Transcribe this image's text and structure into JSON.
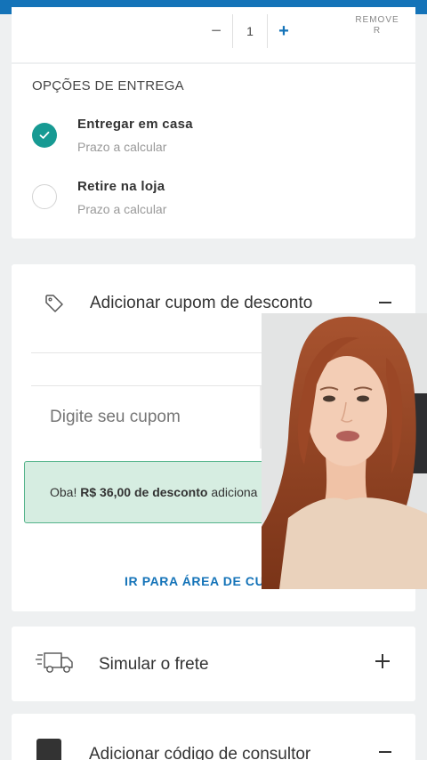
{
  "quantity": {
    "decrement_label": "−",
    "value": "1",
    "increment_label": "+",
    "remove_label": "REMOVE\nR"
  },
  "delivery": {
    "title": "OPÇÕES DE ENTREGA",
    "options": [
      {
        "label": "Entregar em casa",
        "sub": "Prazo a calcular",
        "selected": true
      },
      {
        "label": "Retire na loja",
        "sub": "Prazo a calcular",
        "selected": false
      }
    ]
  },
  "coupon": {
    "title": "Adicionar cupom de desconto",
    "input_placeholder": "Digite seu cupom",
    "success_prefix": "Oba! ",
    "success_bold": "R$ 36,00 de desconto",
    "success_suffix": " adiciona",
    "area_link": "IR PARA ÁREA DE CU"
  },
  "shipping": {
    "title": "Simular o frete"
  },
  "consultant": {
    "title": "Adicionar código de consultor"
  },
  "colors": {
    "accent_blue": "#1473b8",
    "teal_check": "#179a93",
    "success_bg": "#d6ede1",
    "success_border": "#54b38a"
  }
}
